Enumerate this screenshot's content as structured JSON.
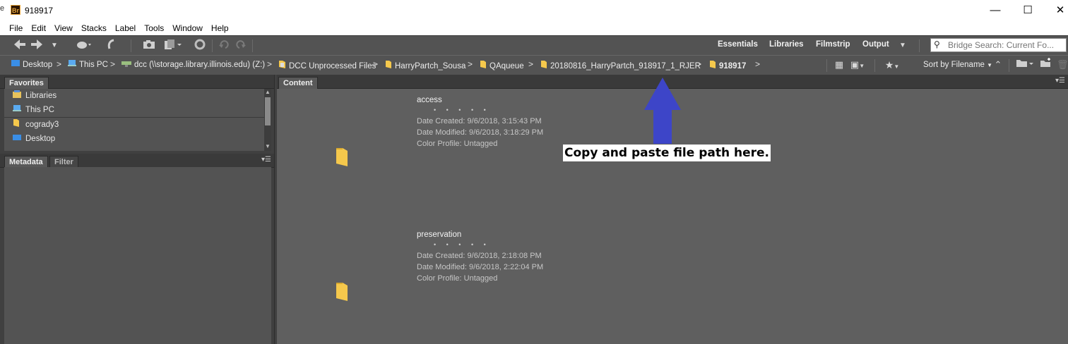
{
  "window": {
    "title": "918917",
    "app_icon_text": "Br",
    "edge_glyph": "e",
    "minimize": "—",
    "maximize": "☐",
    "close": "✕"
  },
  "menu": [
    "File",
    "Edit",
    "View",
    "Stacks",
    "Label",
    "Tools",
    "Window",
    "Help"
  ],
  "workspaces": [
    "Essentials",
    "Libraries",
    "Filmstrip",
    "Output"
  ],
  "search": {
    "placeholder": "Bridge Search: Current Fo..."
  },
  "breadcrumb": [
    {
      "label": "Desktop",
      "icon": "desktop-icon"
    },
    {
      "label": "This PC",
      "icon": "computer-icon"
    },
    {
      "label": "dcc (\\\\storage.library.illinois.edu) (Z:)",
      "icon": "network-drive-icon"
    },
    {
      "label": "DCC Unprocessed Files",
      "icon": "folder-icon"
    },
    {
      "label": "HarryPartch_Sousa",
      "icon": "folder-icon"
    },
    {
      "label": "QAqueue",
      "icon": "folder-icon"
    },
    {
      "label": "20180816_HarryPartch_918917_1_RJER",
      "icon": "folder-icon"
    },
    {
      "label": "918917",
      "icon": "folder-icon"
    }
  ],
  "sort": {
    "label": "Sort by Filename"
  },
  "favorites_panel": {
    "tab": "Favorites",
    "items": [
      {
        "label": "Libraries",
        "icon": "libraries-icon"
      },
      {
        "label": "This PC",
        "icon": "computer-icon"
      },
      {
        "label": "cogrady3",
        "icon": "user-folder-icon"
      },
      {
        "label": "Desktop",
        "icon": "desktop-icon"
      }
    ]
  },
  "lower_panel": {
    "tabs": [
      "Metadata",
      "Filter"
    ]
  },
  "content_panel": {
    "tab": "Content",
    "rating_dots": "• • • • •",
    "items": [
      {
        "name": "access",
        "date_created": "Date Created: 9/6/2018, 3:15:43 PM",
        "date_modified": "Date Modified: 9/6/2018, 3:18:29 PM",
        "color_profile": "Color Profile: Untagged"
      },
      {
        "name": "preservation",
        "date_created": "Date Created: 9/6/2018, 2:18:08 PM",
        "date_modified": "Date Modified: 9/6/2018, 2:22:04 PM",
        "color_profile": "Color Profile: Untagged"
      }
    ]
  },
  "annotation": {
    "text": "Copy and paste file path here.",
    "arrow_color": "#3d45c8"
  },
  "colors": {
    "panel_bg": "#535353",
    "content_bg": "#5f5f5f",
    "folder": "#f5c84c"
  }
}
